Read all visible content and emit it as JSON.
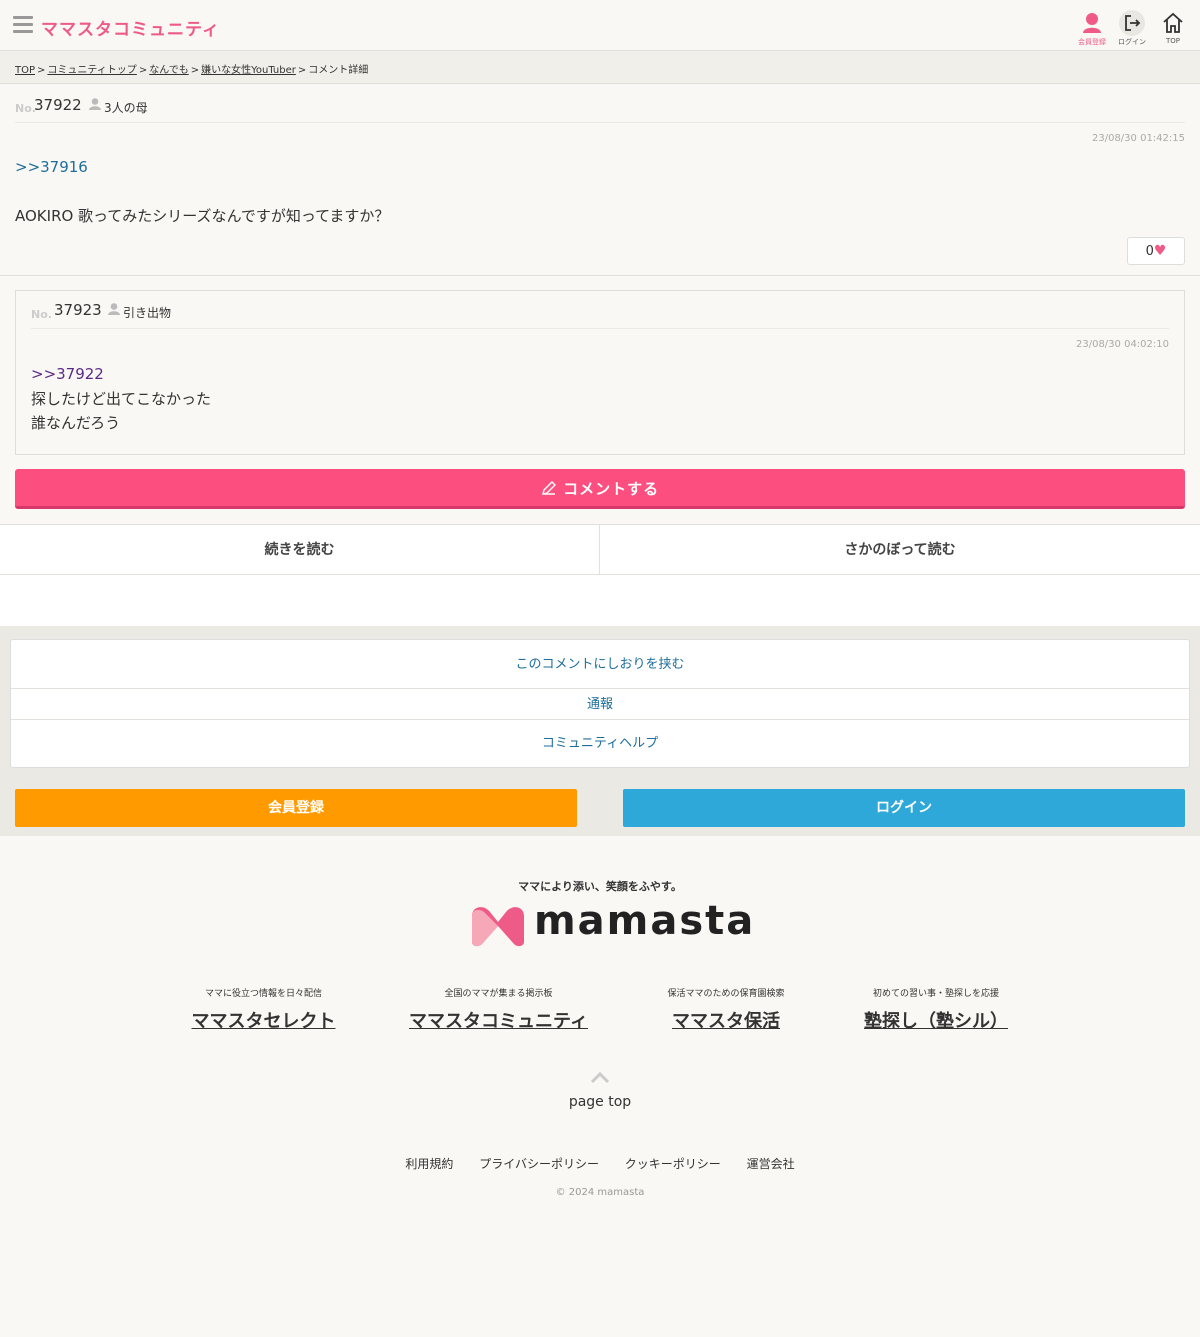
{
  "header": {
    "site_title": "ママスタコミュニティ",
    "register_label": "会員登録",
    "login_label": "ログイン",
    "top_label": "TOP"
  },
  "breadcrumb": {
    "items": [
      "TOP",
      "コミュニティトップ",
      "なんでも",
      "嫌いな女性YouTuber"
    ],
    "current": "コメント詳細",
    "separator": ">"
  },
  "main_comment": {
    "no_label": "No.",
    "number": "37922",
    "user": "3人の母",
    "date": "23/08/30 01:42:15",
    "reply_to": ">>37916",
    "body": "AOKIRO 歌ってみたシリーズなんですが知ってますか？",
    "likes": "0"
  },
  "reply_comment": {
    "no_label": "No.",
    "number": "37923",
    "user": "引き出物",
    "date": "23/08/30 04:02:10",
    "reply_to": ">>37922",
    "body_lines": [
      "探したけど出てこなかった",
      "誰なんだろう"
    ]
  },
  "comment_button": "コメントする",
  "read_next": "続きを読む",
  "read_back": "さかのぼって読む",
  "actions": {
    "bookmark": "このコメントにしおりを挟む",
    "report": "通報",
    "help": "コミュニティヘルプ"
  },
  "auth": {
    "register": "会員登録",
    "login": "ログイン"
  },
  "footer": {
    "tagline": "ママにより添い、笑顔をふやす。",
    "logo_text": "mamasta",
    "services": [
      {
        "desc": "ママに役立つ情報を日々配信",
        "name": "ママスタセレクト"
      },
      {
        "desc": "全国のママが集まる掲示板",
        "name": "ママスタコミュニティ"
      },
      {
        "desc": "保活ママのための保育園検索",
        "name": "ママスタ保活"
      },
      {
        "desc": "初めての習い事・塾探しを応援",
        "name": "塾探し（塾シル）"
      }
    ],
    "page_top": "page top",
    "links": [
      "利用規約",
      "プライバシーポリシー",
      "クッキーポリシー",
      "運営会社"
    ],
    "copyright": "© 2024 mamasta"
  },
  "colors": {
    "brand_pink": "#ee5b86",
    "comment_button": "#fc4f7f",
    "register_orange": "#ff9b00",
    "login_blue": "#2ea7d9",
    "link_blue": "#1d6e9c",
    "reply_purple": "#5b2a86"
  },
  "icons": {
    "menu": "hamburger-icon",
    "register": "user-icon",
    "login": "logout-arrow-icon",
    "top": "home-icon",
    "like": "heart-icon",
    "comment": "pencil-icon",
    "page_top": "chevron-up-icon"
  }
}
